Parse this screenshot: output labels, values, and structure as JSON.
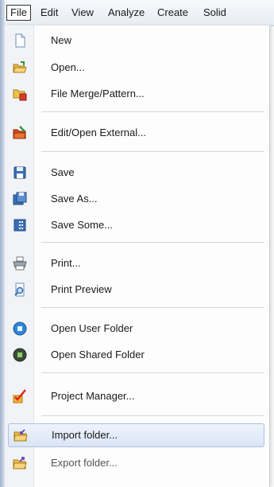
{
  "menubar": {
    "items": [
      "File",
      "Edit",
      "View",
      "Analyze",
      "Create",
      "Solid"
    ]
  },
  "menu": {
    "new": "New",
    "open": "Open...",
    "file_merge": "File Merge/Pattern...",
    "edit_open_external": "Edit/Open External...",
    "save": "Save",
    "save_as": "Save As...",
    "save_some": "Save Some...",
    "print": "Print...",
    "print_preview": "Print Preview",
    "open_user_folder": "Open User Folder",
    "open_shared_folder": "Open Shared Folder",
    "project_manager": "Project Manager...",
    "import_folder": "Import folder...",
    "export_folder": "Export folder..."
  },
  "colors": {
    "highlight": "#dae5f6",
    "highlight_border": "#a9c0e4",
    "accent_blue": "#2f7fd6",
    "folder_yellow": "#f0c24b"
  }
}
